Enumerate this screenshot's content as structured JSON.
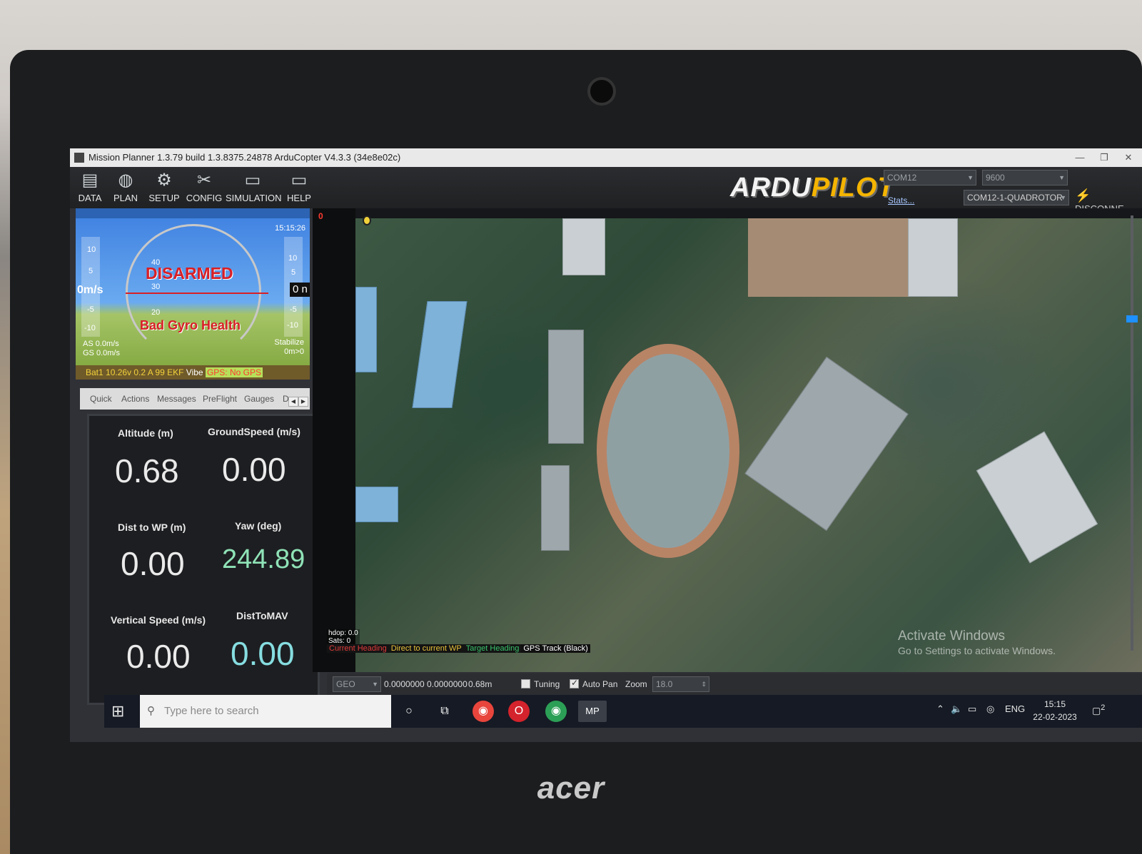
{
  "window": {
    "title": "Mission Planner 1.3.79 build 1.3.8375.24878 ArduCopter V4.3.3 (34e8e02c)"
  },
  "menu": {
    "items": [
      {
        "label": "DATA",
        "icon": "data-icon"
      },
      {
        "label": "PLAN",
        "icon": "globe-icon"
      },
      {
        "label": "SETUP",
        "icon": "gear-icon"
      },
      {
        "label": "CONFIG",
        "icon": "wrench-icon"
      },
      {
        "label": "SIMULATION",
        "icon": "monitor-icon"
      },
      {
        "label": "HELP",
        "icon": "help-icon"
      }
    ],
    "logo_part1": "ARDU",
    "logo_part2": "PILOT",
    "port": "COM12",
    "baud": "9600",
    "stats_label": "Stats...",
    "vehicle": "COM12-1-QUADROTOR",
    "connect_label": "DISCONNE"
  },
  "hud": {
    "time": "15:15:26",
    "status": "DISARMED",
    "warning": "Bad Gyro Health",
    "speed": "0m/s",
    "alt": "0 n",
    "airspeed": "AS 0.0m/s",
    "groundspeed": "GS 0.0m/s",
    "mode": "Stabilize",
    "mode_sub": "0m>0",
    "battery": "Bat1 10.26v 0.2 A 99",
    "ekf": "EKF",
    "vibe": "Vibe",
    "gps": "GPS: No GPS",
    "pitch_marks": [
      "40",
      "30",
      "20"
    ],
    "left_tape": [
      "10",
      "5",
      "-5",
      "-10"
    ],
    "right_tape": [
      "10",
      "5",
      "-5",
      "-10"
    ]
  },
  "tabs": {
    "items": [
      "Quick",
      "Actions",
      "Messages",
      "PreFlight",
      "Gauges",
      "D"
    ]
  },
  "quick": {
    "altitude_label": "Altitude (m)",
    "altitude_value": "0.68",
    "groundspeed_label": "GroundSpeed (m/s)",
    "groundspeed_value": "0.00",
    "dist_wp_label": "Dist to WP (m)",
    "dist_wp_value": "0.00",
    "yaw_label": "Yaw (deg)",
    "yaw_value": "244.89",
    "vspeed_label": "Vertical Speed (m/s)",
    "vspeed_value": "0.00",
    "disttomav_label": "DistToMAV",
    "disttomav_value": "0.00"
  },
  "map": {
    "wp_marker": "0",
    "hdop": "hdop: 0.0",
    "sats": "Sats: 0",
    "legend_heading": "Current Heading",
    "legend_direct": "Direct to current WP",
    "legend_target": "Target Heading",
    "legend_gps": "GPS Track (Black)",
    "activate_title": "Activate Windows",
    "activate_sub": "Go to Settings to activate Windows."
  },
  "mapbar": {
    "coord_type": "GEO",
    "coords": "0.0000000 0.0000000",
    "alt": "0.68m",
    "tuning_label": "Tuning",
    "tuning_checked": false,
    "autopan_label": "Auto Pan",
    "autopan_checked": true,
    "zoom_label": "Zoom",
    "zoom_value": "18.0"
  },
  "taskbar": {
    "search_placeholder": "Type here to search",
    "lang": "ENG",
    "time": "15:15",
    "date": "22-02-2023",
    "notifications": "2"
  },
  "laptop": {
    "brand": "acer"
  }
}
